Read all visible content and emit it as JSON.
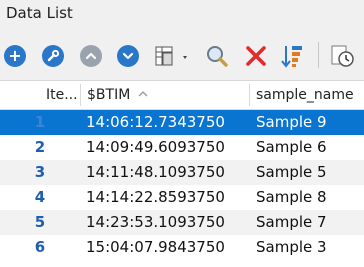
{
  "window": {
    "title": "Data List"
  },
  "toolbar": {
    "icons": [
      "add-icon",
      "wrench-icon",
      "move-up-icon",
      "move-down-icon",
      "column-chooser-icon",
      "search-icon",
      "delete-icon",
      "sort-icon",
      "history-icon"
    ]
  },
  "grid": {
    "columns": [
      {
        "label": "Ite..."
      },
      {
        "label": "$BTIM",
        "sort": "ascending"
      },
      {
        "label": "sample_name"
      }
    ],
    "rows": [
      {
        "item": "1",
        "time": "14:06:12.7343750",
        "name": "Sample 9"
      },
      {
        "item": "2",
        "time": "14:09:49.6093750",
        "name": "Sample 6"
      },
      {
        "item": "3",
        "time": "14:11:48.1093750",
        "name": "Sample 5"
      },
      {
        "item": "4",
        "time": "14:14:22.8593750",
        "name": "Sample 8"
      },
      {
        "item": "5",
        "time": "14:23:53.1093750",
        "name": "Sample 7"
      },
      {
        "item": "6",
        "time": "15:04:07.9843750",
        "name": "Sample 3"
      }
    ],
    "selected_row": 0
  },
  "colors": {
    "selection": "#0a74d1",
    "item_number": "#1d5eb3",
    "toolbar_blue": "#2a77c9"
  }
}
